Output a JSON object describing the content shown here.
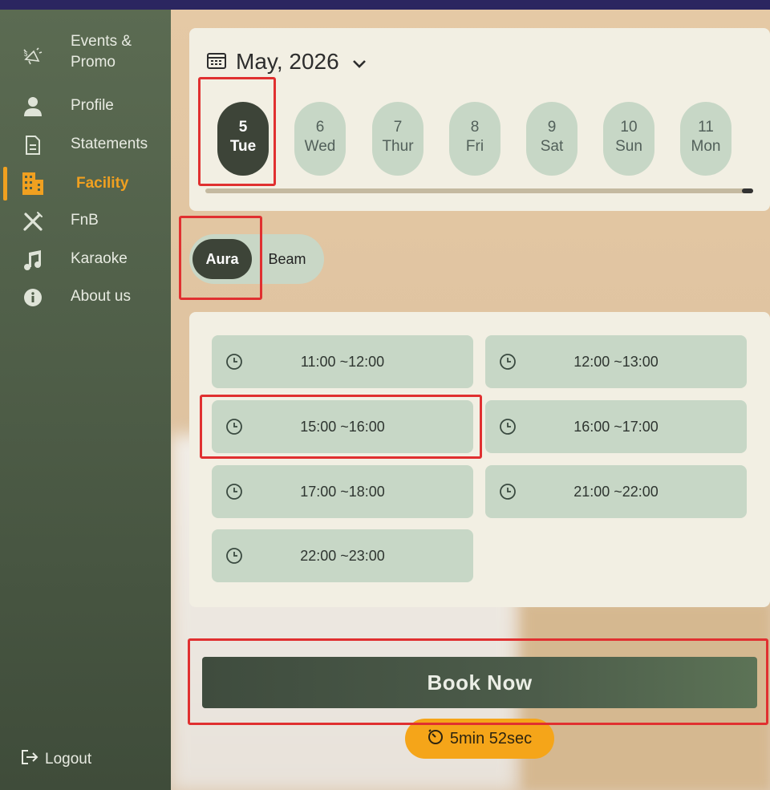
{
  "sidebar": {
    "items": [
      {
        "label_line1": "Events &",
        "label_line2": "Promo",
        "icon": "megaphone-icon"
      },
      {
        "label": "Profile",
        "icon": "person-icon"
      },
      {
        "label": "Statements",
        "icon": "document-icon"
      },
      {
        "label": "Facility",
        "icon": "building-icon",
        "active": true
      },
      {
        "label": "FnB",
        "icon": "utensils-icon"
      },
      {
        "label": "Karaoke",
        "icon": "music-note-icon"
      },
      {
        "label": "About us",
        "icon": "info-icon"
      }
    ],
    "logout": "Logout",
    "active_color": "#f0a020"
  },
  "calendar": {
    "month": "May, 2026",
    "days": [
      {
        "num": "5",
        "dow": "Tue",
        "selected": true
      },
      {
        "num": "6",
        "dow": "Wed"
      },
      {
        "num": "7",
        "dow": "Thur"
      },
      {
        "num": "8",
        "dow": "Fri"
      },
      {
        "num": "9",
        "dow": "Sat"
      },
      {
        "num": "10",
        "dow": "Sun"
      },
      {
        "num": "11",
        "dow": "Mon"
      }
    ]
  },
  "rooms": {
    "selected": "Aura",
    "other": "Beam"
  },
  "slots": [
    "11:00 ~12:00",
    "12:00 ~13:00",
    "15:00 ~16:00",
    "16:00 ~17:00",
    "17:00 ~18:00",
    "21:00 ~22:00",
    "22:00 ~23:00"
  ],
  "book_label": "Book Now",
  "timer": "5min 52sec",
  "colors": {
    "sidebar": "#4f5e48",
    "pill": "#c7d7c6",
    "selected": "#3d4438",
    "accent": "#f5a519",
    "annotation": "#e03030"
  }
}
